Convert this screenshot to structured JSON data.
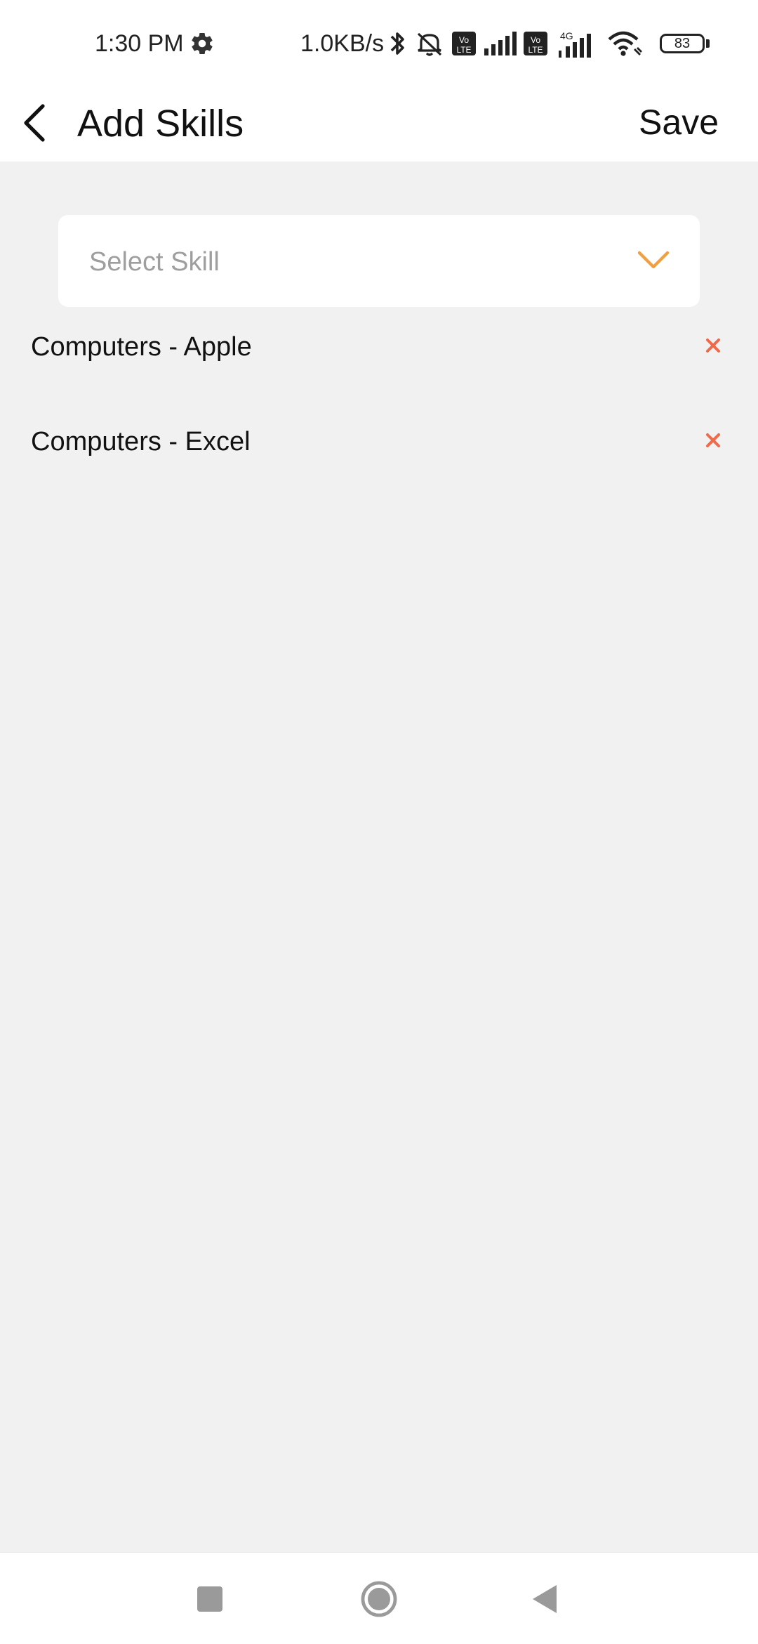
{
  "status_bar": {
    "time": "1:30 PM",
    "net_speed": "1.0KB/s",
    "battery_level": "83",
    "icons": [
      "settings-icon",
      "bluetooth-icon",
      "silent-icon",
      "volte-icon",
      "signal-icon",
      "volte-icon",
      "signal-4g-icon",
      "wifi-icon",
      "battery-icon"
    ]
  },
  "header": {
    "title": "Add Skills",
    "save_label": "Save"
  },
  "select_skill": {
    "placeholder": "Select Skill"
  },
  "skills": [
    {
      "label": "Computers - Apple"
    },
    {
      "label": "Computers - Excel"
    }
  ],
  "colors": {
    "accent": "#f0a040",
    "remove": "#ee6a4a",
    "background": "#f1f1f1"
  }
}
